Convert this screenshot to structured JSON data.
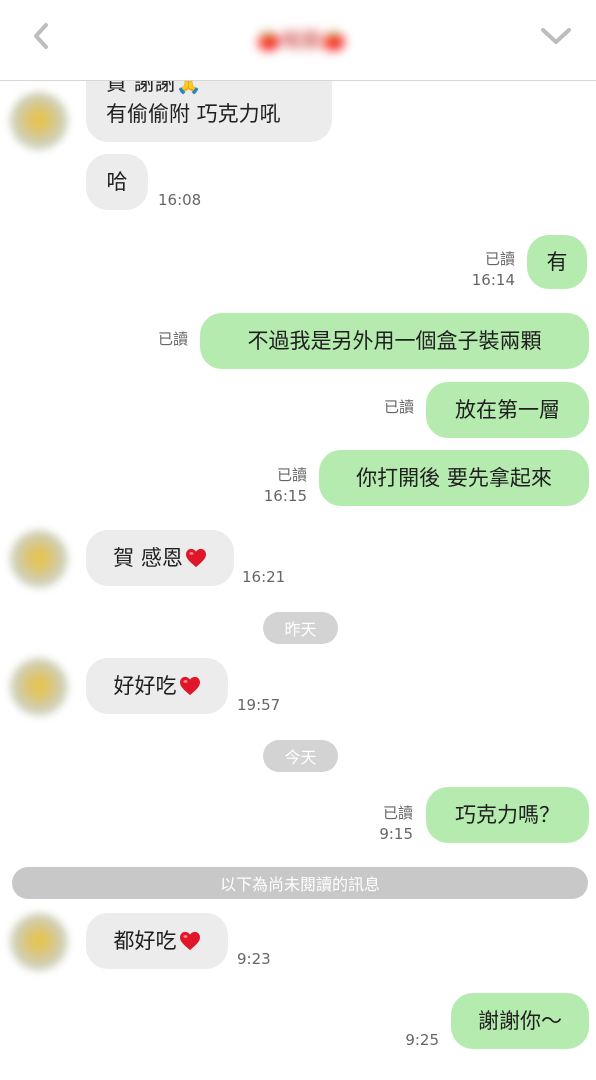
{
  "header": {
    "title": "🍅報圓🍅",
    "back_icon": "back-chevron-icon",
    "menu_icon": "chevron-down-icon"
  },
  "messages": [
    {
      "side": "in",
      "text_line1": "賀 謝謝🙏",
      "text_line2": "有偷偷附 巧克力吼"
    },
    {
      "side": "in",
      "text": "哈",
      "time": "16:08"
    },
    {
      "side": "out",
      "text": "有",
      "read": "已讀",
      "time": "16:14"
    },
    {
      "side": "out",
      "text": "不過我是另外用一個盒子裝兩顆",
      "read": "已讀"
    },
    {
      "side": "out",
      "text": "放在第一層",
      "read": "已讀"
    },
    {
      "side": "out",
      "text": "你打開後 要先拿起來",
      "read": "已讀",
      "time": "16:15"
    },
    {
      "side": "in",
      "text": "賀 感恩",
      "emoji": "heart-emoji",
      "time": "16:21"
    },
    {
      "side": "in",
      "text": "好好吃",
      "emoji": "heart-emoji",
      "time": "19:57"
    },
    {
      "side": "out",
      "text": "巧克力嗎？",
      "read": "已讀",
      "time": "9:15"
    },
    {
      "side": "in",
      "text": "都好吃",
      "emoji": "heart-emoji",
      "time": "9:23"
    },
    {
      "side": "out",
      "text": "謝謝你～",
      "time": "9:25"
    }
  ],
  "dividers": {
    "yesterday": "昨天",
    "today": "今天",
    "unread": "以下為尚未閱讀的訊息"
  },
  "colors": {
    "outgoing_bubble": "#b6ebb0",
    "incoming_bubble": "#ececec",
    "heart": "#e0162b"
  }
}
